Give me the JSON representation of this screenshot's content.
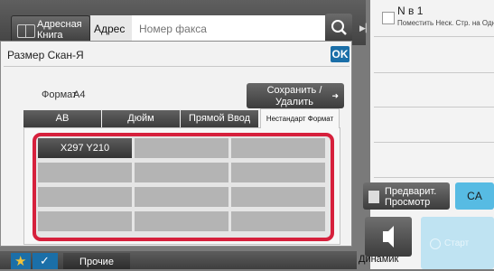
{
  "top_bar": {
    "address_book_label": "Адресная Книга",
    "address_label": "Адрес",
    "fax_input_placeholder": "Номер факса",
    "search_icon": "search-icon",
    "collapse_icon": "chevron-right-icon"
  },
  "dialog": {
    "title": "Размер Скан-Я",
    "ok_label": "OK",
    "format_label": "Формат",
    "format_value": "A4",
    "save_delete_label": "Сохранить /Удалить",
    "tabs": [
      {
        "label": "AB",
        "selected": false
      },
      {
        "label": "Дюйм",
        "selected": false
      },
      {
        "label": "Прямой Ввод",
        "selected": false
      },
      {
        "label": "Нестандарт Формат",
        "selected": true
      }
    ],
    "custom_sizes": [
      "X297 Y210",
      "",
      "",
      "",
      "",
      "",
      "",
      "",
      "",
      "",
      "",
      ""
    ],
    "selected_size_index": 0,
    "highlight_color": "#d6203c"
  },
  "right_panel": {
    "job_title": "N в 1",
    "job_subtitle": "Поместить Неск. Стр. на Одной",
    "preview_label": "Предварит. Просмотр",
    "ca_label": "CA",
    "speaker_label": "Динамик",
    "start_label": "Старт",
    "ca_color": "#57bbe3"
  },
  "bottom_bar": {
    "favorites_icon": "star-icon",
    "check_icon": "check-icon",
    "other_label": "Прочие"
  }
}
